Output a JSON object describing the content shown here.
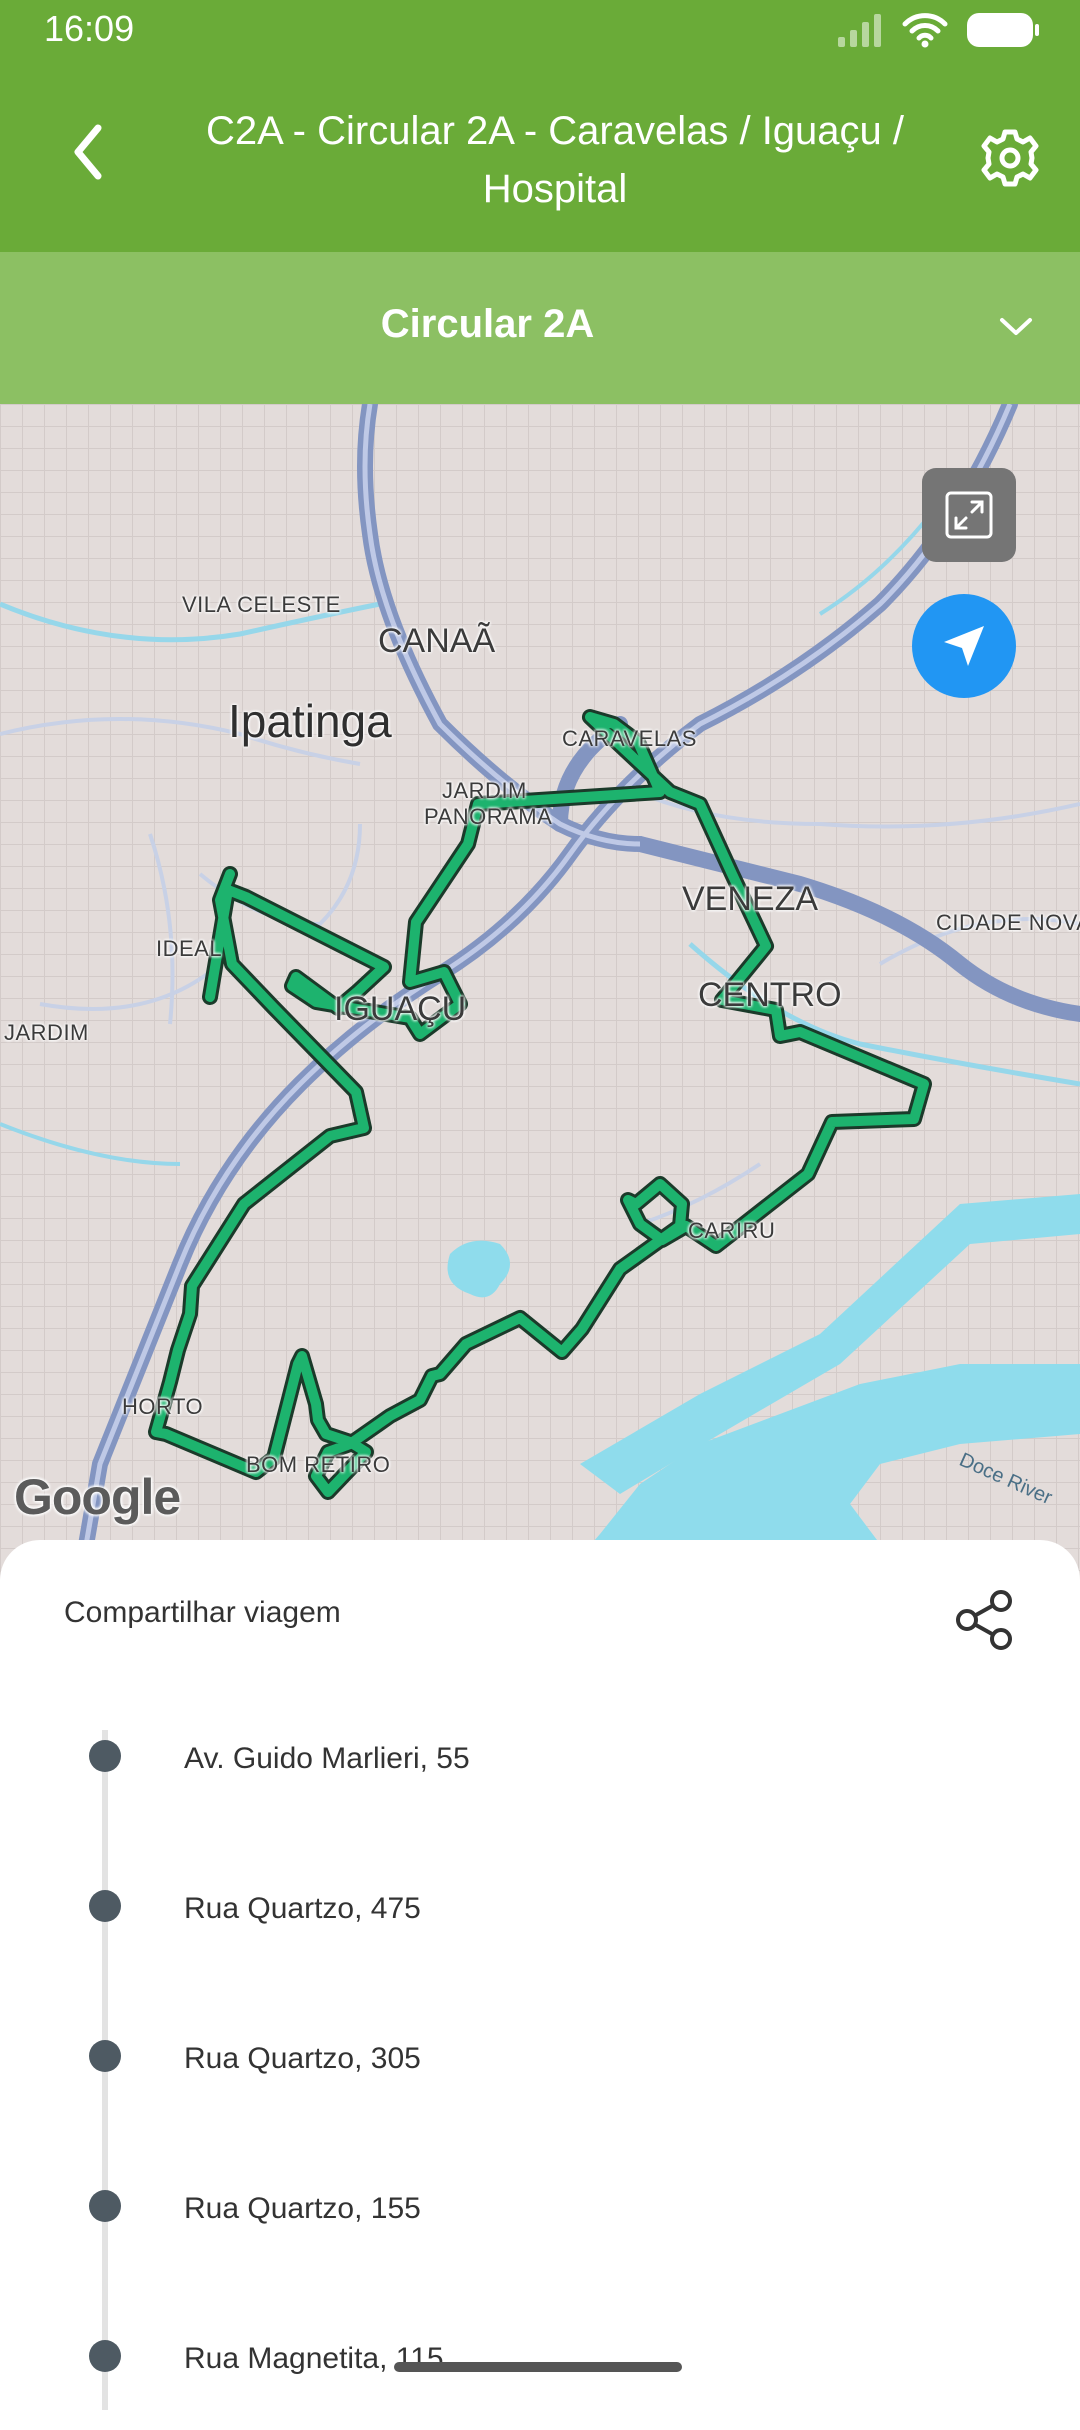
{
  "status_bar": {
    "time": "16:09"
  },
  "header": {
    "title_line1": "C2A - Circular 2A - Caravelas / Iguaçu /",
    "title_line2": "Hospital"
  },
  "route_selector": {
    "label": "Circular 2A"
  },
  "map": {
    "labels": {
      "vila_celeste": "VILA CELESTE",
      "canaa": "CANAÃ",
      "ipatinga": "Ipatinga",
      "caravelas": "CARAVELAS",
      "jardim_panorama_1": "JARDIM",
      "jardim_panorama_2": "PANORAMA",
      "veneza": "VENEZA",
      "cidade_nova": "CIDADE NOVA",
      "ideal": "IDEAL",
      "iguacu": "IGUAÇU",
      "centro": "CENTRO",
      "jardim": "JARDIM",
      "cariru": "CARIRU",
      "horto": "HORTO",
      "bom_retiro": "BOM RETIRO",
      "doce_river": "Doce River"
    },
    "attribution": "Google",
    "route_color": "#1db36e"
  },
  "sheet": {
    "share_label": "Compartilhar viagem",
    "stops": [
      {
        "name": "Av. Guido Marlieri, 55"
      },
      {
        "name": "Rua Quartzo, 475"
      },
      {
        "name": "Rua Quartzo, 305"
      },
      {
        "name": "Rua Quartzo, 155"
      },
      {
        "name": "Rua Magnetita, 115"
      }
    ]
  },
  "colors": {
    "header_green": "#6aab38",
    "selector_green": "#8cc063",
    "locate_blue": "#2196f3"
  },
  "icons": {
    "back": "chevron-left-icon",
    "settings": "gear-icon",
    "dropdown": "chevron-down-icon",
    "expand": "expand-icon",
    "locate": "navigation-arrow-icon",
    "share": "share-icon"
  }
}
